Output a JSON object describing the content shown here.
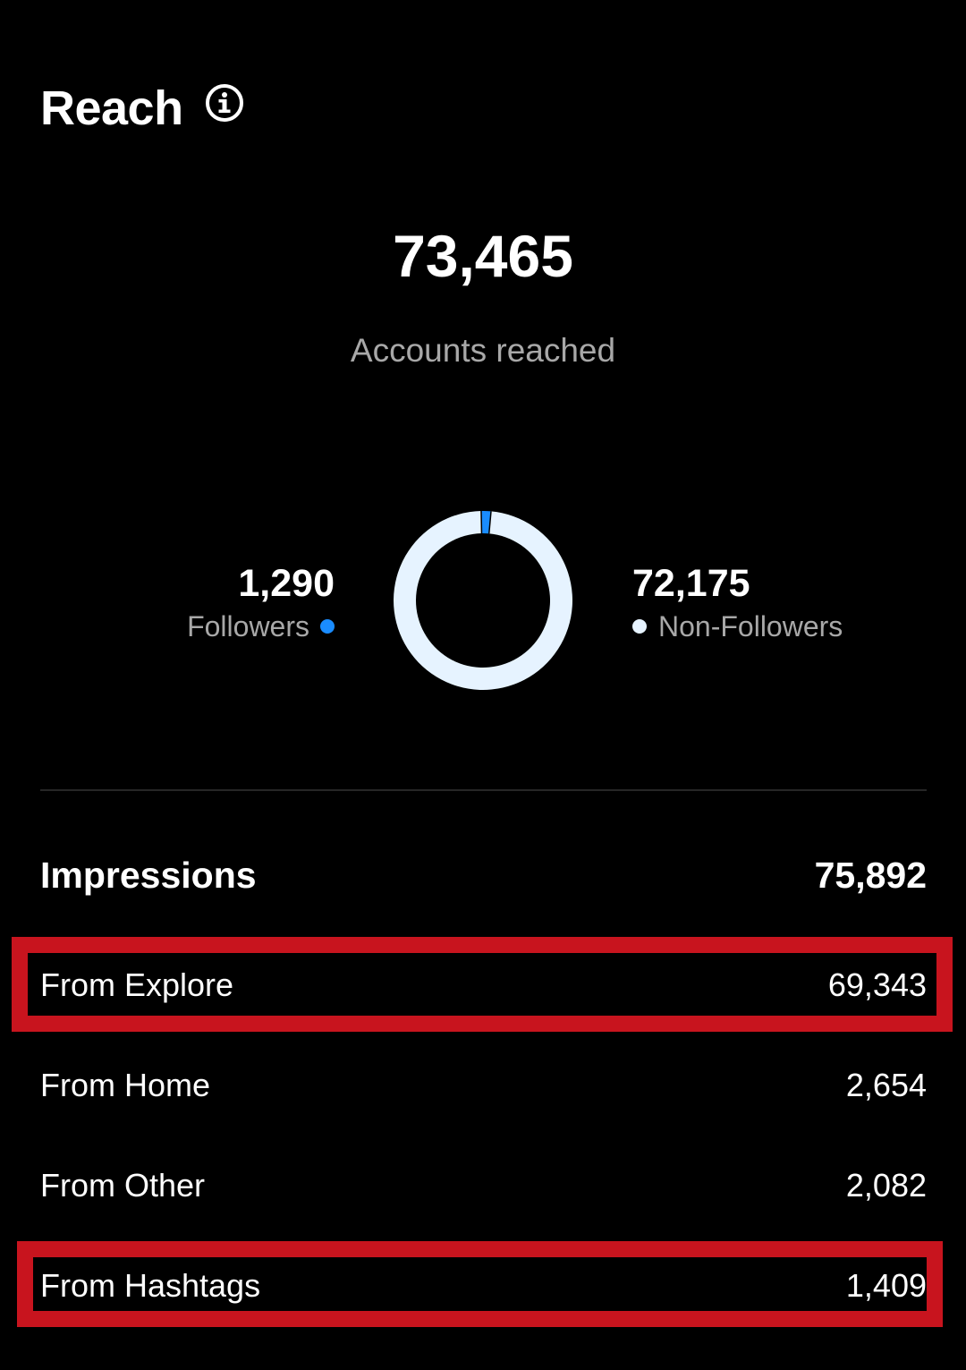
{
  "header": {
    "title": "Reach",
    "info_icon": "info-circle-icon"
  },
  "reach": {
    "total": "73,465",
    "total_label": "Accounts reached",
    "followers": {
      "value": "1,290",
      "label": "Followers",
      "color": "#1a8cff"
    },
    "non_followers": {
      "value": "72,175",
      "label": "Non-Followers",
      "color": "#e6f3ff"
    }
  },
  "chart_data": {
    "type": "pie",
    "categories": [
      "Followers",
      "Non-Followers"
    ],
    "values": [
      1290,
      72175
    ],
    "colors": [
      "#1a8cff",
      "#e6f3ff"
    ],
    "title": "",
    "donut": true
  },
  "impressions": {
    "label": "Impressions",
    "value": "75,892",
    "sources": [
      {
        "label": "From Explore",
        "value": "69,343",
        "highlighted": true
      },
      {
        "label": "From Home",
        "value": "2,654",
        "highlighted": false
      },
      {
        "label": "From Other",
        "value": "2,082",
        "highlighted": false
      },
      {
        "label": "From Hashtags",
        "value": "1,409",
        "highlighted": true
      }
    ]
  },
  "colors": {
    "background": "#000000",
    "text_primary": "#ffffff",
    "text_secondary": "#a8a8a8",
    "divider": "#262626",
    "highlight_box": "#c8141e"
  }
}
